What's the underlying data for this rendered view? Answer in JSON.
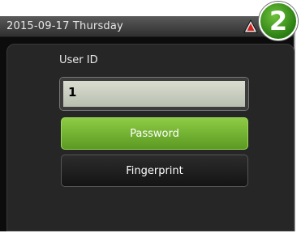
{
  "status": {
    "datetime": "2015-09-17  Thursday"
  },
  "badge": {
    "number": "2"
  },
  "form": {
    "user_id_label": "User ID",
    "user_id_value": "1"
  },
  "buttons": {
    "password": "Password",
    "fingerprint": "Fingerprint"
  },
  "icons": {
    "warning": "warning-icon"
  },
  "colors": {
    "accent_green": "#7bbd38",
    "warning_red": "#d32020"
  }
}
